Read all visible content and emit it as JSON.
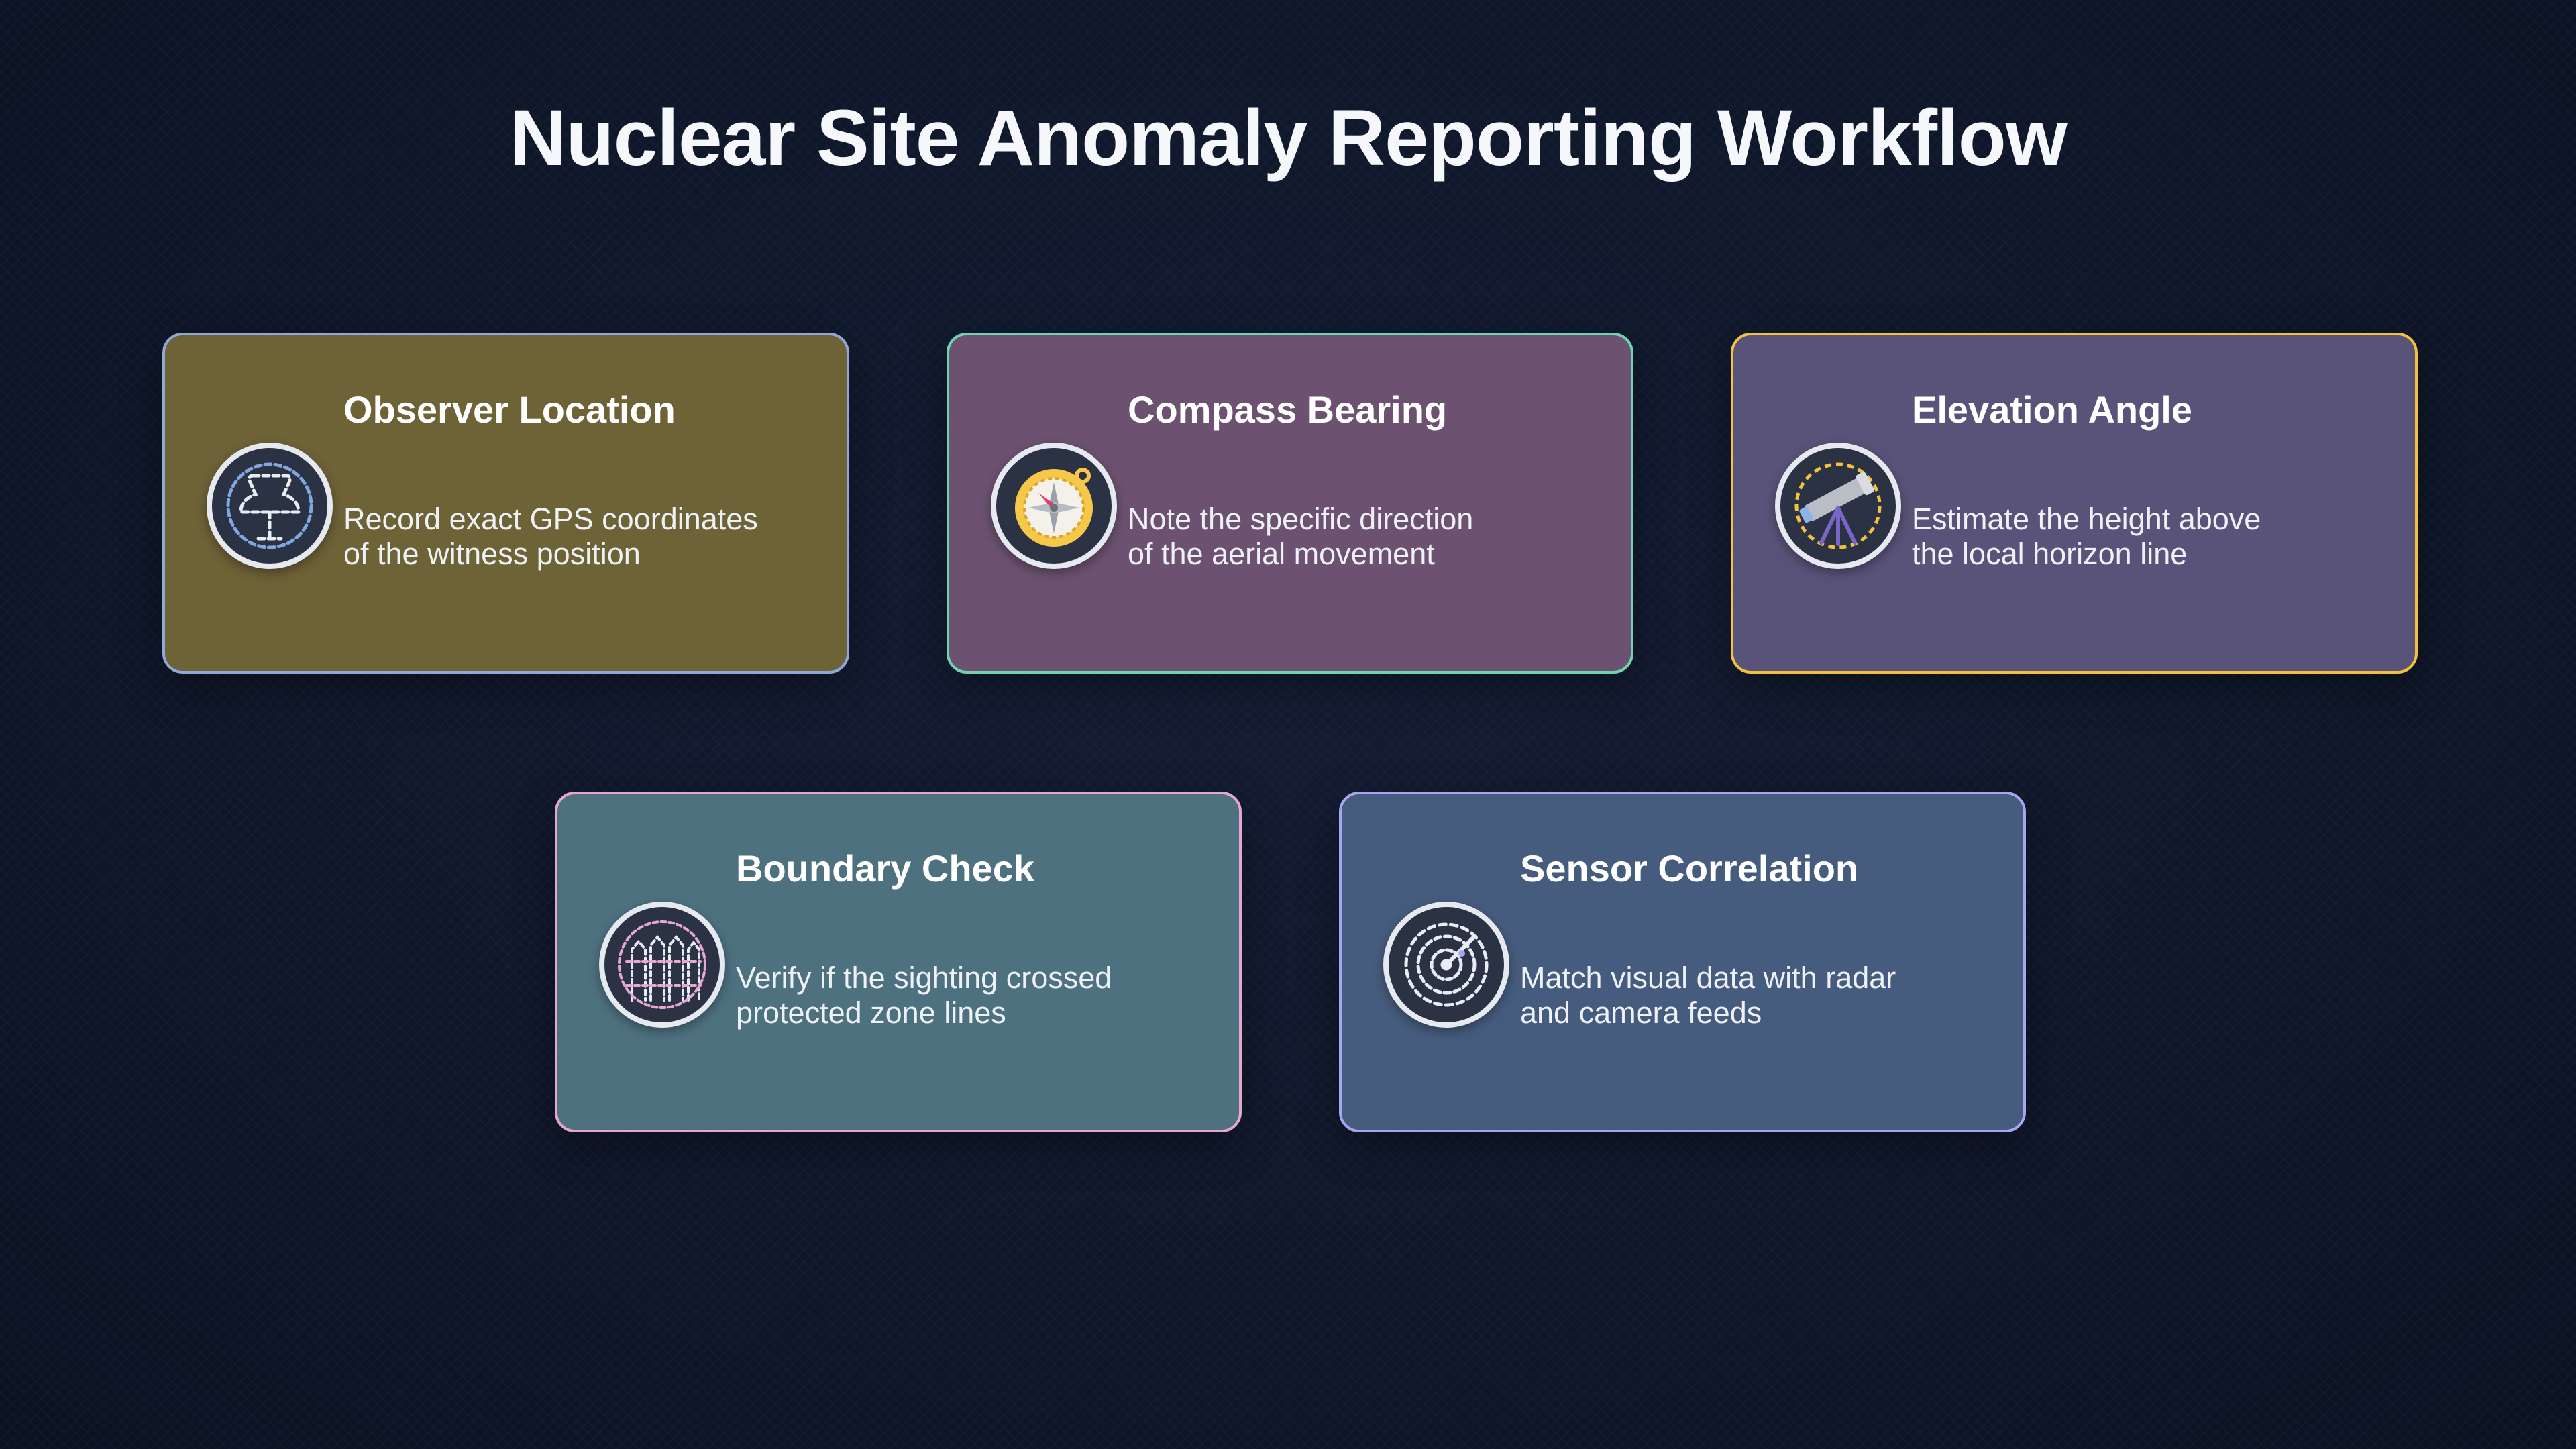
{
  "title": "Nuclear Site Anomaly Reporting Workflow",
  "cards": [
    {
      "heading": "Observer Location",
      "description_line1": "Record exact GPS coordinates",
      "description_line2": "of the witness position",
      "icon": "map-pin-icon",
      "background": "#6e6237",
      "border": "#8fa8d8"
    },
    {
      "heading": "Compass Bearing",
      "description_line1": "Note the specific direction",
      "description_line2": "of the aerial movement",
      "icon": "compass-icon",
      "background": "#6c5270",
      "border": "#6fd3b1"
    },
    {
      "heading": "Elevation Angle",
      "description_line1": "Estimate the height above",
      "description_line2": "the local horizon line",
      "icon": "telescope-icon",
      "background": "#5a5379",
      "border": "#f0c23e"
    },
    {
      "heading": "Boundary Check",
      "description_line1": "Verify if the sighting crossed",
      "description_line2": "protected zone lines",
      "icon": "fence-icon",
      "background": "#4e7180",
      "border": "#e6a6cf"
    },
    {
      "heading": "Sensor Correlation",
      "description_line1": "Match visual data with radar",
      "description_line2": "and camera feeds",
      "icon": "radar-icon",
      "background": "#465c7e",
      "border": "#a6a6f0"
    }
  ]
}
